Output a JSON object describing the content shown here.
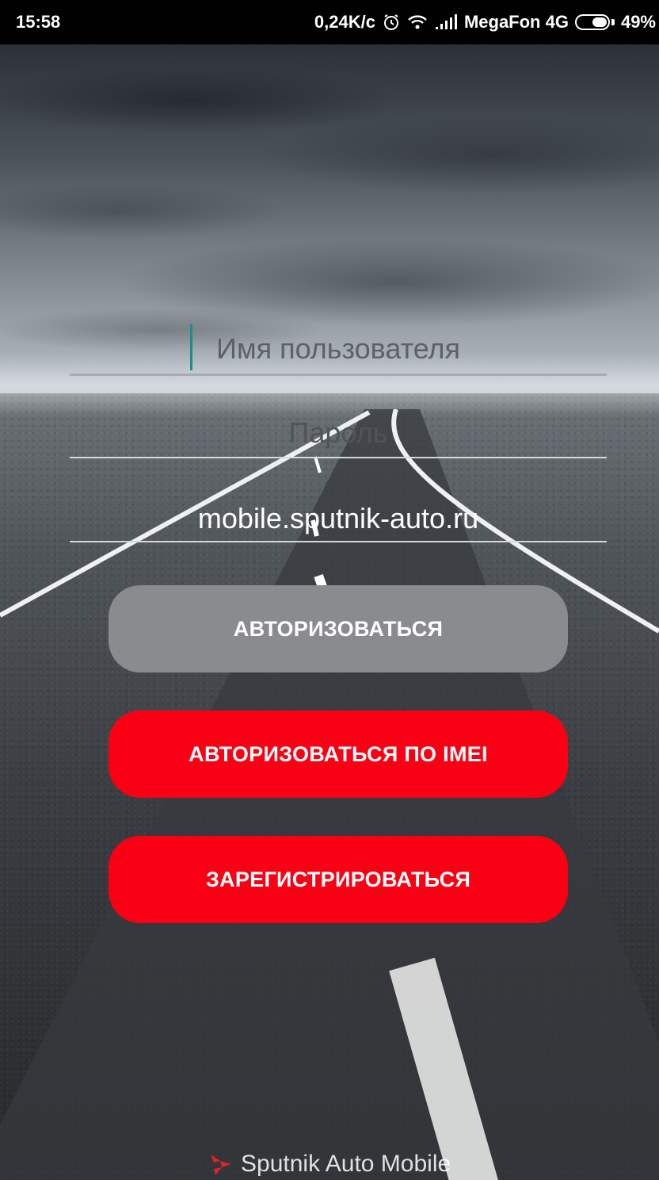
{
  "status_bar": {
    "time": "15:58",
    "net_speed": "0,24K/c",
    "carrier": "MegaFon 4G",
    "battery": "49%",
    "icons": [
      "alarm-icon",
      "wifi-icon",
      "signal-icon",
      "battery-icon"
    ]
  },
  "login": {
    "username_placeholder": "Имя пользователя",
    "username_value": "",
    "password_placeholder": "Пароль",
    "password_value": "",
    "server_value": "mobile.sputnik-auto.ru"
  },
  "buttons": {
    "authorize": "АВТОРИЗОВАТЬСЯ",
    "authorize_imei": "АВТОРИЗОВАТЬСЯ ПО IMEI",
    "register": "ЗАРЕГИСТРИРОВАТЬСЯ"
  },
  "footer": {
    "app_name": "Sputnik Auto Mobile"
  },
  "colors": {
    "primary_red": "#fa0014",
    "disabled_gray": "#8a8b8e",
    "cursor_teal": "#1b8f85"
  }
}
